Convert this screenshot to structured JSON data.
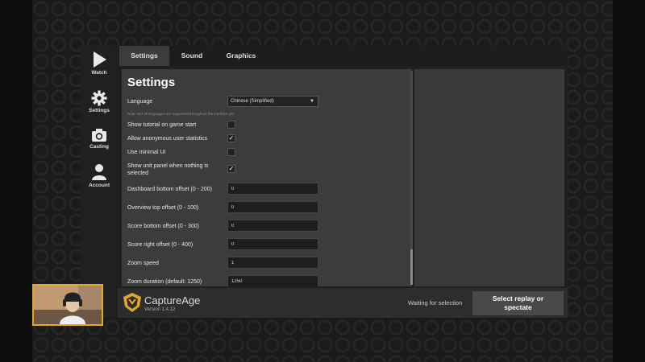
{
  "sidebar": {
    "items": [
      {
        "label": "Watch",
        "icon": "play-icon"
      },
      {
        "label": "Settings",
        "icon": "gear-icon"
      },
      {
        "label": "Casting",
        "icon": "camera-icon"
      },
      {
        "label": "Account",
        "icon": "user-icon"
      }
    ]
  },
  "tabs": [
    {
      "label": "Settings",
      "active": true
    },
    {
      "label": "Sound",
      "active": false
    },
    {
      "label": "Graphics",
      "active": false
    }
  ],
  "settings": {
    "heading": "Settings",
    "language_label": "Language",
    "language_value": "Chinese (Simplified)",
    "language_note": "Note: Not all languages are supported throughout the interface yet.",
    "checkboxes": [
      {
        "label": "Show tutorial on game start",
        "checked": false
      },
      {
        "label": "Allow anonymous user statistics",
        "checked": true
      },
      {
        "label": "Use minimal UI",
        "checked": false
      },
      {
        "label": "Show unit panel when nothing is selected",
        "checked": true
      }
    ],
    "check_mark": "✓",
    "fields": [
      {
        "label": "Dashboard bottom offset (0 - 200)",
        "value": "0"
      },
      {
        "label": "Overview top offset (0 - 100)",
        "value": "0"
      },
      {
        "label": "Score bottom offset (0 - 300)",
        "value": "0"
      },
      {
        "label": "Score right offset (0 - 400)",
        "value": "0"
      },
      {
        "label": "Zoom speed",
        "value": "1"
      },
      {
        "label": "Zoom duration (default: 1250)",
        "value": "1250"
      }
    ]
  },
  "footer": {
    "brand": "CaptureAge",
    "version": "Version 1.4.12",
    "status": "Waiting for selection",
    "cta_line1": "Select replay or",
    "cta_line2": "spectate"
  },
  "colors": {
    "accent_gold": "#e0a92b",
    "panel": "#3c3c3c",
    "background": "#1b1b1b"
  }
}
